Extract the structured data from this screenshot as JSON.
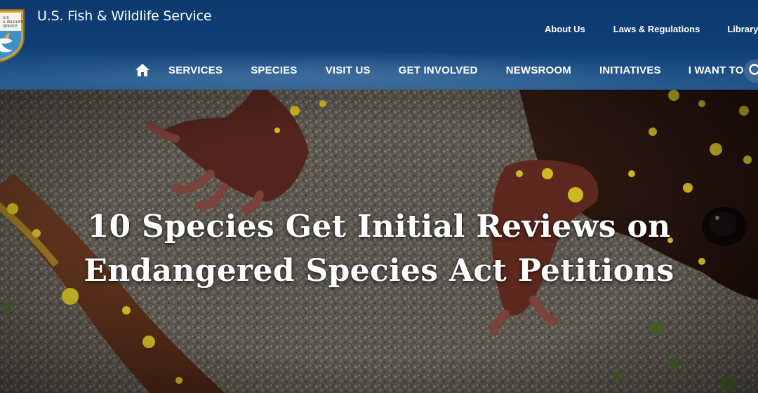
{
  "site": {
    "title": "U.S. Fish & Wildlife Service",
    "logo_icon": "usfws-badge-icon"
  },
  "utility_nav": {
    "items": [
      "About Us",
      "Laws & Regulations",
      "Library"
    ]
  },
  "main_nav": {
    "home_icon": "home-icon",
    "items": [
      "SERVICES",
      "SPECIES",
      "VISIT US",
      "GET INVOLVED",
      "NEWSROOM",
      "INITIATIVES",
      "I WANT TO"
    ],
    "search_icon": "search-icon"
  },
  "hero": {
    "title_line1": "10 Species Get Initial Reviews on",
    "title_line2": "Endangered Species Act Petitions"
  },
  "colors": {
    "header_blue": "#0f3f77",
    "text_white": "#ffffff",
    "salamander_spot": "#e8d32a"
  }
}
